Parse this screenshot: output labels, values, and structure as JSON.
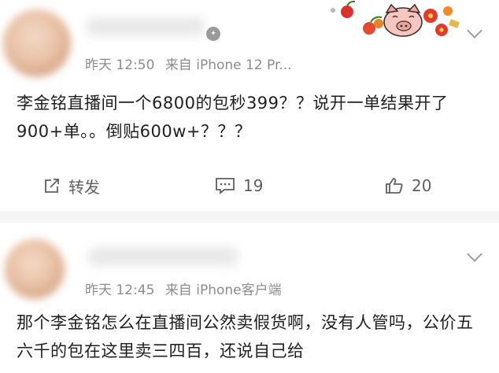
{
  "post1": {
    "meta_time": "昨天 12:50",
    "meta_source": "来自 iPhone 12 Pr...",
    "content": "李金铭直播间一个6800的包秒399？？说开一单结果开了900+单。。倒贴600w+？？？",
    "actions": {
      "repost_label": "转发",
      "comment_count": "19",
      "like_count": "20"
    }
  },
  "post2": {
    "meta_time": "昨天 12:45",
    "meta_source": "来自 iPhone客户端",
    "content": "那个李金铭怎么在直播间公然卖假货啊，没有人管吗，公价五六千的包在这里卖三四百，还说自己给"
  },
  "colors": {
    "page_bg": "#f5f5f5",
    "card_bg": "#ffffff",
    "meta_text": "#8c8c8c",
    "body_text": "#1f1f1f",
    "icon_gray": "#5f5f5f"
  }
}
